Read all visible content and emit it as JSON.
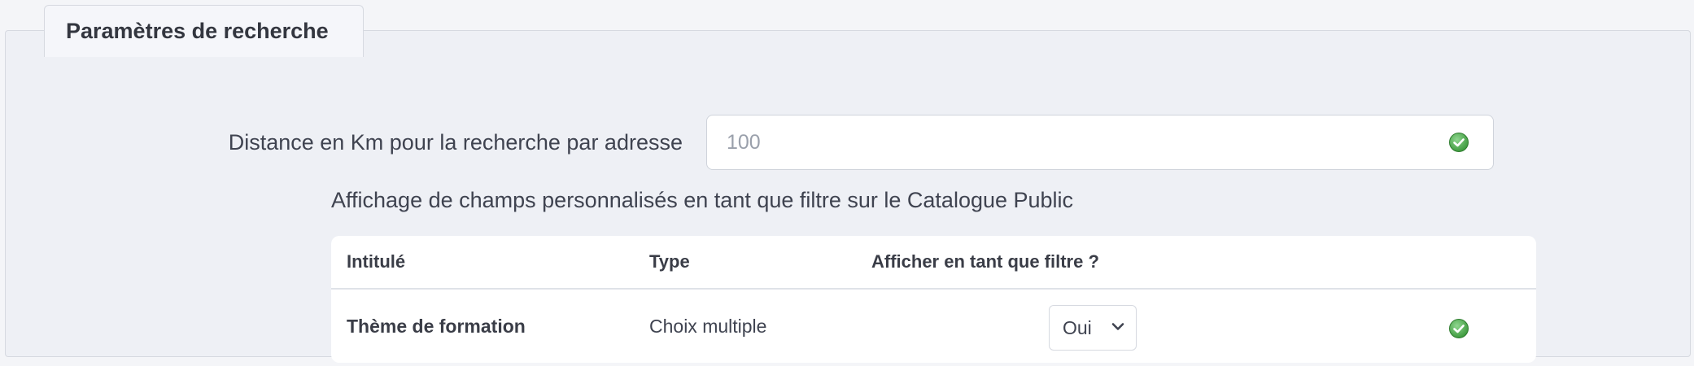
{
  "panel": {
    "tab_title": "Paramètres de recherche"
  },
  "distance": {
    "label": "Distance en Km pour la recherche par adresse",
    "placeholder": "100",
    "value": ""
  },
  "custom_fields": {
    "heading": "Affichage de champs personnalisés en tant que filtre sur le Catalogue Public",
    "columns": {
      "title": "Intitulé",
      "type": "Type",
      "show_as_filter": "Afficher en tant que filtre ?"
    },
    "rows": [
      {
        "title": "Thème de formation",
        "type": "Choix multiple",
        "show_as_filter": "Oui"
      }
    ]
  },
  "colors": {
    "check_green": "#5cb85c",
    "panel_bg": "#eef0f5",
    "border": "#d6d9e0"
  },
  "icons": {
    "status": "check-circle-icon",
    "select": "chevron-down-icon"
  }
}
